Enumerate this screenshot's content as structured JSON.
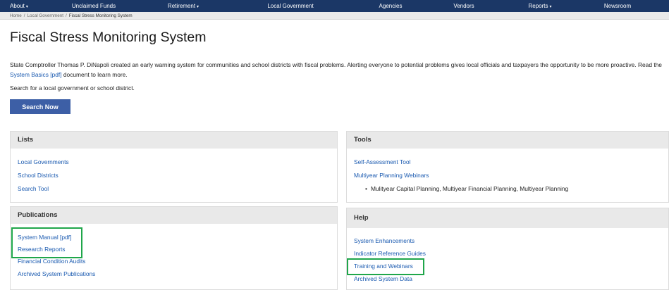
{
  "nav": {
    "items": [
      {
        "label": "About",
        "caret": "▾"
      },
      {
        "label": "Unclaimed Funds",
        "caret": ""
      },
      {
        "label": "Retirement",
        "caret": "▾"
      },
      {
        "label": "Local Government",
        "caret": ""
      },
      {
        "label": "Agencies",
        "caret": ""
      },
      {
        "label": "Vendors",
        "caret": ""
      },
      {
        "label": "Reports",
        "caret": "▾"
      },
      {
        "label": "Newsroom",
        "caret": ""
      }
    ]
  },
  "breadcrumb": {
    "home": "Home",
    "separator": "/",
    "local_government": "Local Government",
    "current": "Fiscal Stress Monitoring System"
  },
  "page_title": "Fiscal Stress Monitoring System",
  "intro": {
    "text_before": "State Comptroller Thomas P. DiNapoli created an early warning system for communities and school districts with fiscal problems. Alerting everyone to potential problems gives local officials and taxpayers the opportunity to be more proactive. Read the ",
    "link": "System Basics [pdf]",
    "text_after": " document to learn more."
  },
  "search_prompt": "Search for a local government or school district.",
  "search_button": "Search Now",
  "panels": {
    "lists": {
      "title": "Lists",
      "links": [
        "Local Governments",
        "School Districts",
        "Search Tool"
      ]
    },
    "tools": {
      "title": "Tools",
      "links": [
        "Self-Assessment Tool",
        "Multiyear Planning Webinars"
      ],
      "bullet": "•",
      "subitem": "Mulityear Capital Planning, Multiyear Financial Planning, Multiyear Planning"
    },
    "publications": {
      "title": "Publications",
      "links": [
        "System Manual [pdf]",
        "Research Reports",
        "Financial Condition Audits",
        "Archived System Publications"
      ]
    },
    "help": {
      "title": "Help",
      "links": [
        "System Enhancements",
        "Indicator Reference Guides",
        "Training and Webinars",
        "Archived System Data"
      ]
    }
  },
  "colors": {
    "nav_bg": "#1b3766",
    "link": "#1a5ab0",
    "button": "#3d5fa6",
    "highlight": "#1fa64a",
    "panel_head": "#e9e9e9"
  }
}
